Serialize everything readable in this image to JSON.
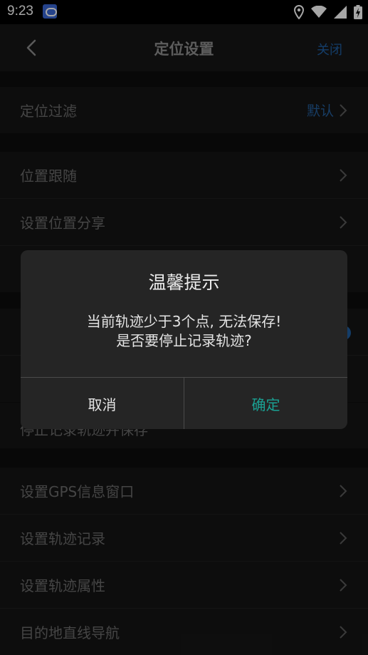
{
  "status": {
    "time": "9:23"
  },
  "header": {
    "title": "定位设置",
    "close_label": "关闭"
  },
  "sections": {
    "filter": {
      "label": "定位过滤",
      "value": "默认"
    },
    "s2": [
      {
        "label": "位置跟随"
      },
      {
        "label": "设置位置分享"
      }
    ],
    "s4": [
      {
        "label": "停止记录轨迹并保存"
      }
    ],
    "s5": [
      {
        "label": "设置GPS信息窗口"
      },
      {
        "label": "设置轨迹记录"
      },
      {
        "label": "设置轨迹属性"
      },
      {
        "label": "目的地直线导航"
      }
    ]
  },
  "dialog": {
    "title": "温馨提示",
    "line1": "当前轨迹少于3个点, 无法保存!",
    "line2": "是否要停止记录轨迹?",
    "cancel_label": "取消",
    "confirm_label": "确定"
  },
  "colors": {
    "accent": "#1aa193",
    "link": "#1f5ea1"
  }
}
